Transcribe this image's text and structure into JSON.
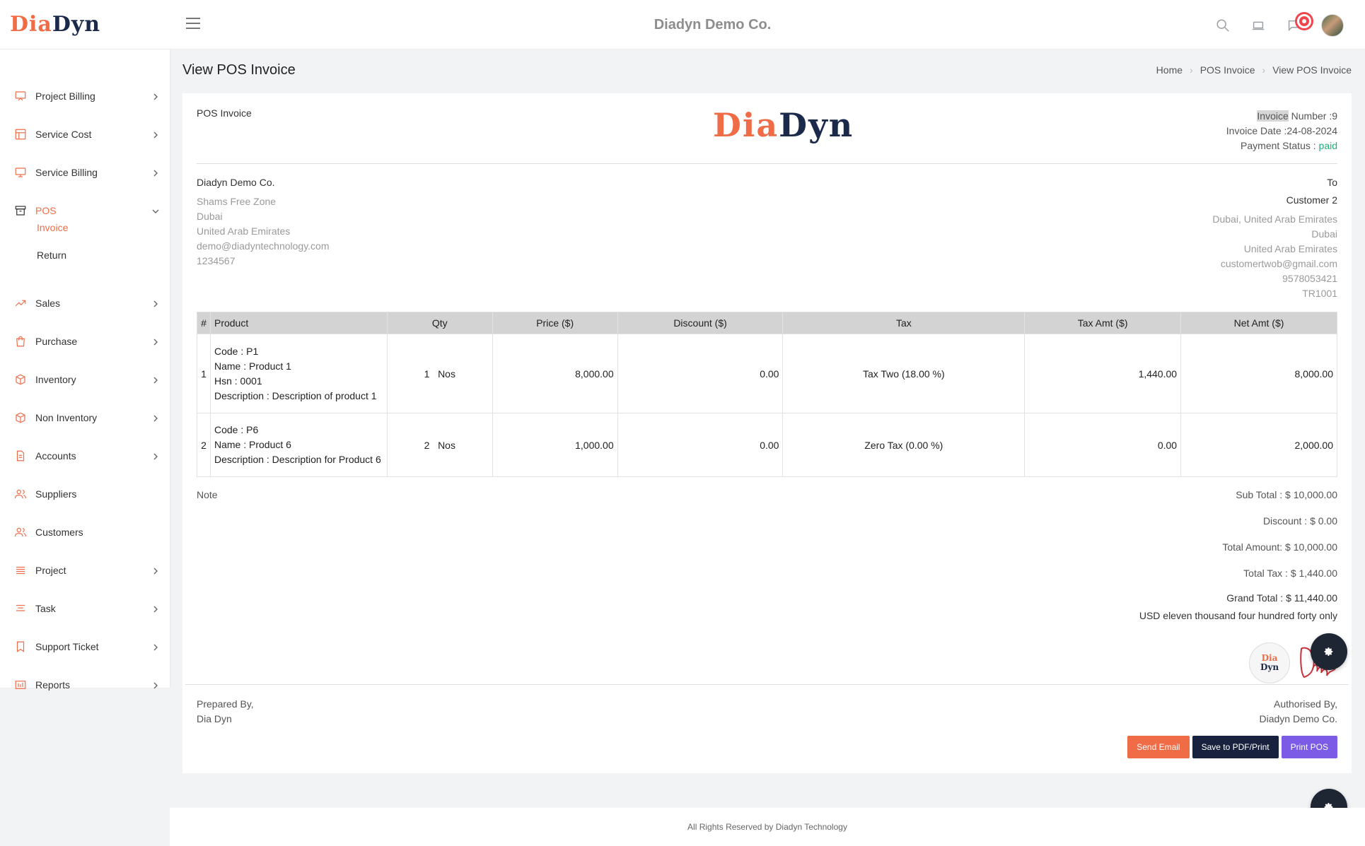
{
  "brand": {
    "part1": "Dia",
    "part2": "Dyn"
  },
  "header": {
    "company": "Diadyn Demo Co."
  },
  "sidebar": {
    "items": [
      {
        "label": "Project Billing"
      },
      {
        "label": "Service Cost"
      },
      {
        "label": "Service Billing"
      },
      {
        "label": "POS"
      },
      {
        "label": "Sales"
      },
      {
        "label": "Purchase"
      },
      {
        "label": "Inventory"
      },
      {
        "label": "Non Inventory"
      },
      {
        "label": "Accounts"
      },
      {
        "label": "Suppliers"
      },
      {
        "label": "Customers"
      },
      {
        "label": "Project"
      },
      {
        "label": "Task"
      },
      {
        "label": "Support Ticket"
      },
      {
        "label": "Reports"
      }
    ],
    "pos_sub": [
      {
        "label": "Invoice"
      },
      {
        "label": "Return"
      }
    ]
  },
  "page": {
    "title": "View POS Invoice",
    "breadcrumb": [
      "Home",
      "POS Invoice",
      "View POS Invoice"
    ]
  },
  "invoice": {
    "heading": "POS Invoice",
    "number_label_hl": "Invoice",
    "number_label_rest": " Number :9",
    "date": "Invoice Date :24-08-2024",
    "status_label": "Payment Status : ",
    "status_value": "paid",
    "from": {
      "name": "Diadyn Demo Co.",
      "address1": "Shams Free Zone",
      "city": "Dubai",
      "country": "United Arab Emirates",
      "email": "demo@diadyntechnology.com",
      "phone": "1234567"
    },
    "to": {
      "label": "To",
      "name": "Customer 2",
      "address1": "Dubai, United Arab Emirates",
      "city": "Dubai",
      "country": "United Arab Emirates",
      "email": "customertwob@gmail.com",
      "phone": "9578053421",
      "trn": "TR1001"
    },
    "columns": [
      "#",
      "Product",
      "Qty",
      "Price ($)",
      "Discount ($)",
      "Tax",
      "Tax Amt ($)",
      "Net Amt ($)"
    ],
    "rows": [
      {
        "no": "1",
        "code": "Code : P1",
        "name": "Name : Product 1",
        "hsn": "Hsn : 0001",
        "desc": "Description : Description of product 1",
        "qty": "1",
        "unit": "Nos",
        "price": "8,000.00",
        "discount": "0.00",
        "tax": "Tax Two (18.00 %)",
        "tax_amt": "1,440.00",
        "net_amt": "8,000.00"
      },
      {
        "no": "2",
        "code": "Code : P6",
        "name": "Name : Product 6",
        "desc": "Description : Description for Product 6",
        "qty": "2",
        "unit": "Nos",
        "price": "1,000.00",
        "discount": "0.00",
        "tax": "Zero Tax (0.00 %)",
        "tax_amt": "0.00",
        "net_amt": "2,000.00"
      }
    ],
    "note_label": "Note",
    "totals": {
      "sub_total": "Sub Total : $ 10,000.00",
      "discount": "Discount : $ 0.00",
      "total_amount": "Total Amount: $ 10,000.00",
      "total_tax": "Total Tax : $ 1,440.00",
      "grand_total": "Grand Total : $ 11,440.00",
      "in_words": "USD eleven thousand four hundred forty only"
    },
    "prepared_label": "Prepared By,",
    "prepared_name": "Dia Dyn",
    "authorised_label": "Authorised By,",
    "authorised_name": "Diadyn Demo Co."
  },
  "buttons": {
    "send_email": "Send Email",
    "save_pdf": "Save to PDF/Print",
    "print_pos": "Print POS"
  },
  "footer": {
    "text": "All Rights Reserved by Diadyn Technology"
  },
  "colors": {
    "accent": "#ef6c47",
    "navy": "#18223f",
    "purple": "#7c5ce6",
    "paid": "#20b27a"
  }
}
